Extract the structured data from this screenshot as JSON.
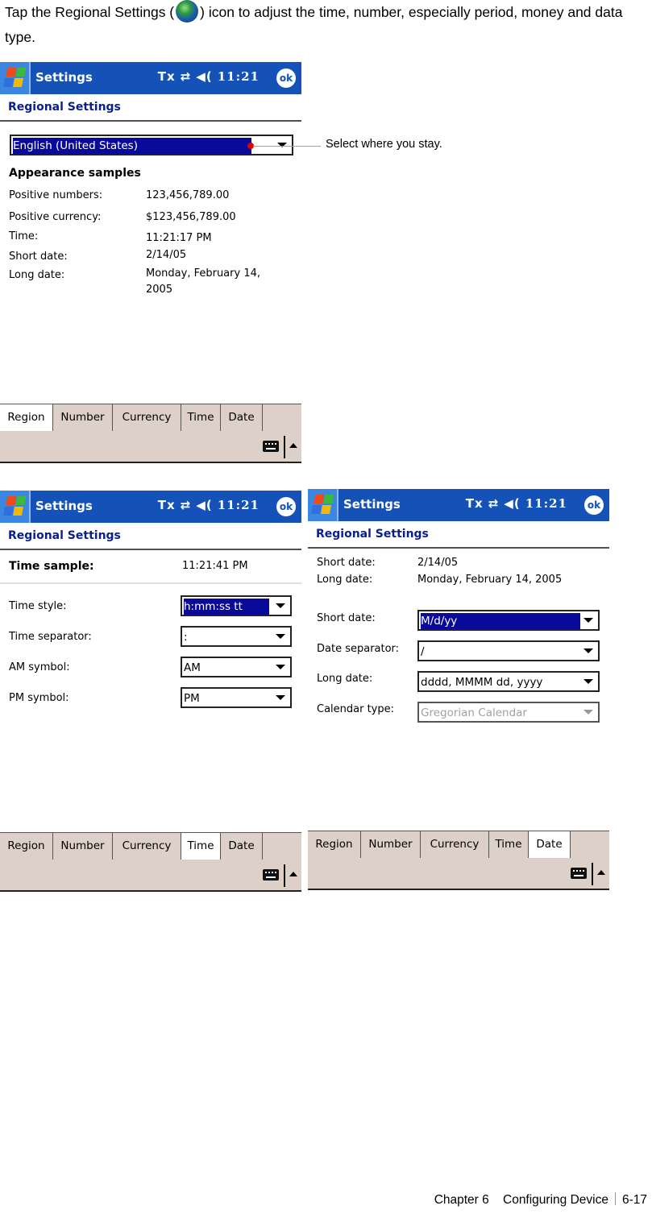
{
  "intro": {
    "text_before_icon": "Tap the Regional Settings (",
    "icon": "regional-settings-globe-icon",
    "text_after_icon": ") icon to adjust the time, number, especially period, money and data type."
  },
  "common": {
    "app_title": "Settings",
    "page_title": "Regional Settings",
    "status": {
      "antenna": "Tx",
      "sync": "⇄",
      "speaker": "◀(",
      "clock": "11:21"
    },
    "ok_label": "ok",
    "tabs": [
      "Region",
      "Number",
      "Currency",
      "Time",
      "Date"
    ]
  },
  "region_screen": {
    "active_tab": "Region",
    "region_dropdown": "English (United States)",
    "appearance_heading": "Appearance samples",
    "samples": [
      {
        "label": "Positive numbers:",
        "value": "123,456,789.00"
      },
      {
        "label": "Positive currency:",
        "value": "$123,456,789.00"
      },
      {
        "label": "Time:",
        "value": "11:21:17 PM"
      },
      {
        "label": "Short date:",
        "value": "2/14/05"
      },
      {
        "label": "Long date:",
        "value": "Monday, February 14,",
        "value2": "2005"
      }
    ],
    "callout": "Select where you stay."
  },
  "time_screen": {
    "active_tab": "Time",
    "sample_label": "Time sample:",
    "sample_value": "11:21:41 PM",
    "fields": [
      {
        "label": "Time style:",
        "value": "h:mm:ss tt"
      },
      {
        "label": "Time separator:",
        "value": ":"
      },
      {
        "label": "AM symbol:",
        "value": "AM"
      },
      {
        "label": "PM symbol:",
        "value": "PM"
      }
    ]
  },
  "date_screen": {
    "active_tab": "Date",
    "samples": [
      {
        "label": "Short date:",
        "value": "2/14/05"
      },
      {
        "label": "Long date:",
        "value": "Monday, February 14, 2005"
      }
    ],
    "fields": [
      {
        "label": "Short date:",
        "value": "M/d/yy"
      },
      {
        "label": "Date separator:",
        "value": "/"
      },
      {
        "label": "Long date:",
        "value": "dddd, MMMM dd, yyyy"
      },
      {
        "label": "Calendar type:",
        "value": "Gregorian Calendar",
        "disabled": true
      }
    ]
  },
  "footer": {
    "chapter": "Chapter 6",
    "section": "Configuring Device",
    "page": "6-17"
  }
}
